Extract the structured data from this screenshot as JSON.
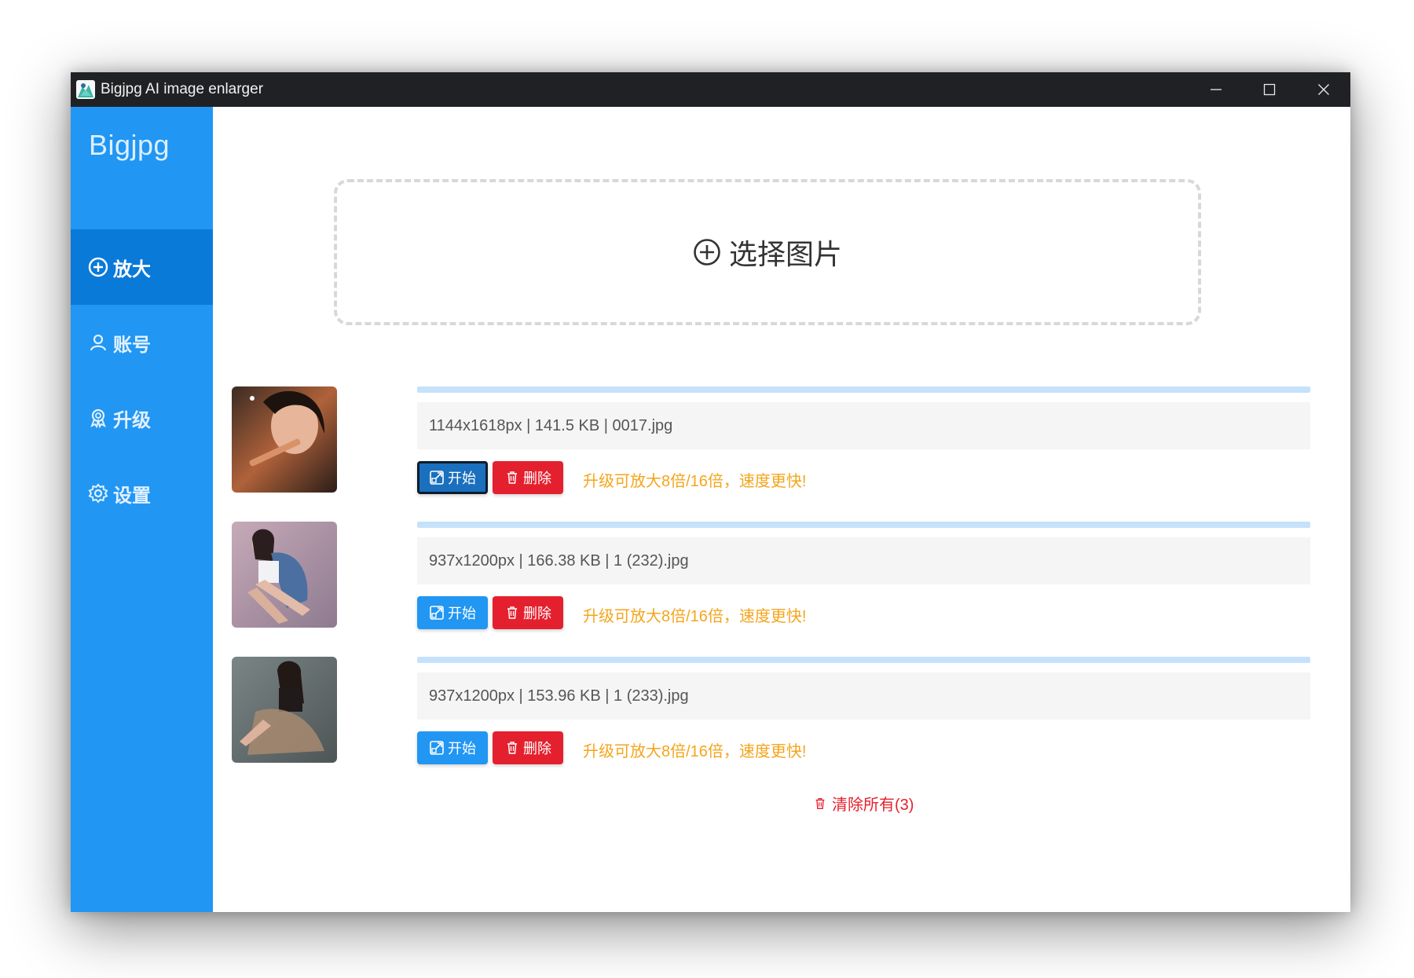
{
  "window": {
    "title": "Bigjpg AI image enlarger",
    "app_icon": "bigjpg-app-icon"
  },
  "sidebar": {
    "brand": "Bigjpg",
    "items": [
      {
        "label": "放大",
        "icon": "plus-circle-icon",
        "active": true
      },
      {
        "label": "账号",
        "icon": "user-icon",
        "active": false
      },
      {
        "label": "升级",
        "icon": "award-icon",
        "active": false
      },
      {
        "label": "设置",
        "icon": "gear-icon",
        "active": false
      }
    ]
  },
  "dropzone": {
    "label": "选择图片",
    "icon": "plus-circle-icon"
  },
  "files": [
    {
      "info": "1144x1618px | 141.5 KB | 0017.jpg",
      "start_label": "开始",
      "delete_label": "删除",
      "promo": "升级可放大8倍/16倍，速度更快!",
      "progress": 0,
      "focused": true
    },
    {
      "info": "937x1200px | 166.38 KB | 1 (232).jpg",
      "start_label": "开始",
      "delete_label": "删除",
      "promo": "升级可放大8倍/16倍，速度更快!",
      "progress": 0,
      "focused": false
    },
    {
      "info": "937x1200px | 153.96 KB | 1 (233).jpg",
      "start_label": "开始",
      "delete_label": "删除",
      "promo": "升级可放大8倍/16倍，速度更快!",
      "progress": 0,
      "focused": false
    }
  ],
  "clear_all": {
    "label": "清除所有(3)",
    "icon": "trash-icon"
  },
  "colors": {
    "sidebar": "#2196f3",
    "sidebar_active": "#0a7ad8",
    "start": "#2196f3",
    "delete": "#e5202e",
    "promo": "#f4a51c",
    "titlebar": "#202124"
  }
}
